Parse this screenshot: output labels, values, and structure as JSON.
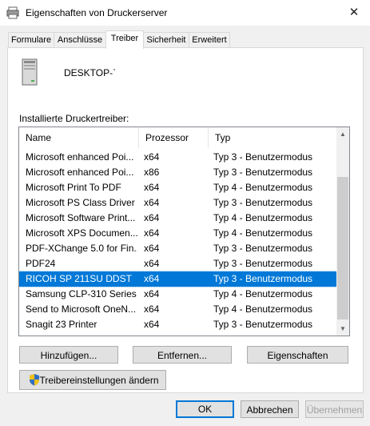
{
  "window": {
    "title": "Eigenschaften von Druckerserver",
    "close_glyph": "✕"
  },
  "tabs": [
    {
      "label": "Formulare"
    },
    {
      "label": "Anschlüsse"
    },
    {
      "label": "Treiber",
      "active": true
    },
    {
      "label": "Sicherheit"
    },
    {
      "label": "Erweitert"
    }
  ],
  "server": {
    "name": "DESKTOP-`",
    "icon": "computer-tower-icon"
  },
  "drivers": {
    "label": "Installierte Druckertreiber:",
    "columns": [
      "Name",
      "Prozessor",
      "Typ"
    ],
    "rows": [
      {
        "name": "Microsoft enhanced Poi...",
        "processor": "x64",
        "type": "Typ 3 - Benutzermodus"
      },
      {
        "name": "Microsoft enhanced Poi...",
        "processor": "x86",
        "type": "Typ 3 - Benutzermodus"
      },
      {
        "name": "Microsoft Print To PDF",
        "processor": "x64",
        "type": "Typ 4 - Benutzermodus"
      },
      {
        "name": "Microsoft PS Class Driver",
        "processor": "x64",
        "type": "Typ 3 - Benutzermodus"
      },
      {
        "name": "Microsoft Software Print...",
        "processor": "x64",
        "type": "Typ 4 - Benutzermodus"
      },
      {
        "name": "Microsoft XPS Documen...",
        "processor": "x64",
        "type": "Typ 4 - Benutzermodus"
      },
      {
        "name": "PDF-XChange 5.0 for Fin...",
        "processor": "x64",
        "type": "Typ 3 - Benutzermodus"
      },
      {
        "name": "PDF24",
        "processor": "x64",
        "type": "Typ 3 - Benutzermodus"
      },
      {
        "name": "RICOH SP 211SU DDST",
        "processor": "x64",
        "type": "Typ 3 - Benutzermodus",
        "selected": true
      },
      {
        "name": "Samsung CLP-310 Series ...",
        "processor": "x64",
        "type": "Typ 4 - Benutzermodus"
      },
      {
        "name": "Send to Microsoft OneN...",
        "processor": "x64",
        "type": "Typ 4 - Benutzermodus"
      },
      {
        "name": "Snagit 23 Printer",
        "processor": "x64",
        "type": "Typ 3 - Benutzermodus"
      }
    ],
    "selected_color": "#0078d7"
  },
  "actions": {
    "add": "Hinzufügen...",
    "remove": "Entfernen...",
    "properties": "Eigenschaften",
    "change_settings": "Treibereinstellungen ändern"
  },
  "footer": {
    "ok": "OK",
    "cancel": "Abbrechen",
    "apply": "Übernehmen"
  },
  "colors": {
    "accent": "#0078d7",
    "shield_blue": "#2f6fc4",
    "shield_yellow": "#f2c21b"
  }
}
